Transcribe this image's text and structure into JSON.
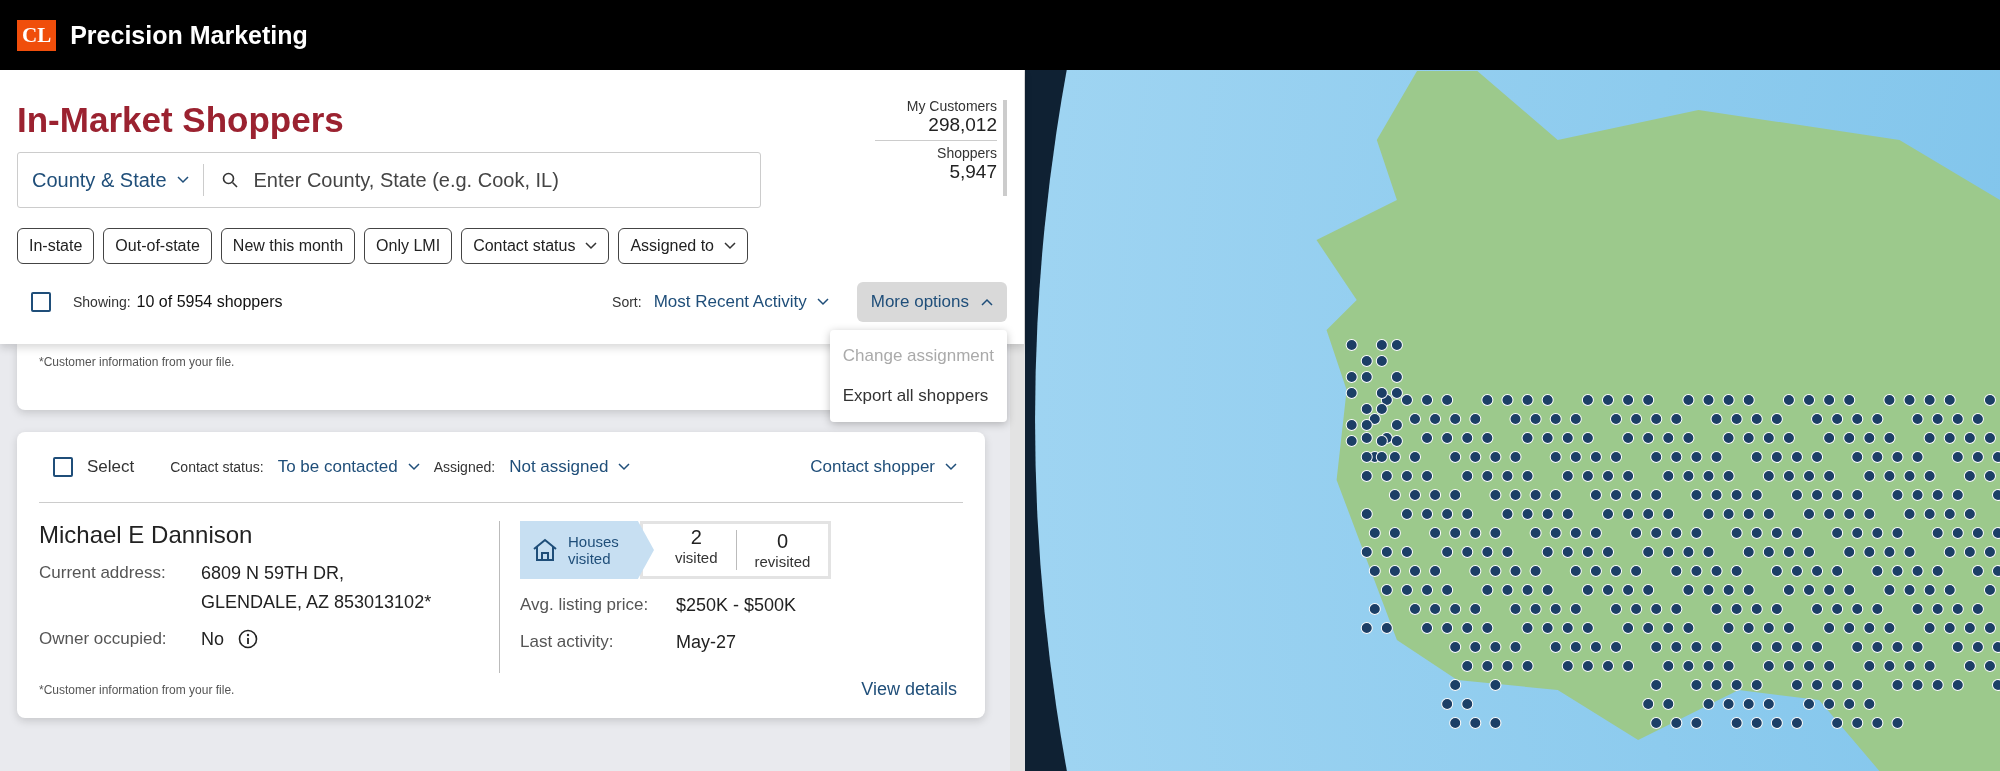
{
  "app_bar": {
    "logo": "CL",
    "title": "Precision Marketing"
  },
  "header": {
    "title": "In-Market Shoppers",
    "stats": [
      {
        "label": "My Customers",
        "value": "298,012"
      },
      {
        "label": "Shoppers",
        "value": "5,947"
      }
    ]
  },
  "search": {
    "scope": "County & State",
    "placeholder": "Enter County, State (e.g. Cook, IL)"
  },
  "filters": [
    {
      "label": "In-state",
      "kind": "toggle"
    },
    {
      "label": "Out-of-state",
      "kind": "toggle"
    },
    {
      "label": "New this month",
      "kind": "toggle"
    },
    {
      "label": "Only LMI",
      "kind": "toggle"
    },
    {
      "label": "Contact status",
      "kind": "dropdown"
    },
    {
      "label": "Assigned to",
      "kind": "dropdown"
    }
  ],
  "results": {
    "checked": false,
    "showing_label": "Showing:",
    "showing_value": "10 of 5954 shoppers",
    "sort_label": "Sort:",
    "sort_value": "Most Recent Activity"
  },
  "more_options": {
    "label": "More options",
    "expanded": true,
    "items": [
      {
        "label": "Change assignment",
        "disabled": true
      },
      {
        "label": "Export all shoppers",
        "disabled": false
      }
    ]
  },
  "previous_card": {
    "footnote": "*Customer information from your file."
  },
  "card": {
    "checked": false,
    "select_label": "Select",
    "contact_status_label": "Contact status:",
    "contact_status": "To be contacted",
    "assigned_label": "Assigned:",
    "assigned": "Not assigned",
    "contact_action": "Contact shopper",
    "name": "Michael E Dannison",
    "fields": [
      {
        "label": "Current address:",
        "value": "6809 N 59TH DR,\nGLENDALE, AZ 853013102*",
        "info": false
      },
      {
        "label": "Owner occupied:",
        "value": "No",
        "info": true
      }
    ],
    "houses_label": "Houses visited",
    "visits": [
      {
        "value": "2",
        "label": "visited"
      },
      {
        "value": "0",
        "label": "revisited"
      }
    ],
    "details": [
      {
        "label": "Avg. listing price:",
        "value": "$250K - $500K"
      },
      {
        "label": "Last activity:",
        "value": "May-27"
      }
    ],
    "footnote": "*Customer information from your file.",
    "link": "View details"
  }
}
